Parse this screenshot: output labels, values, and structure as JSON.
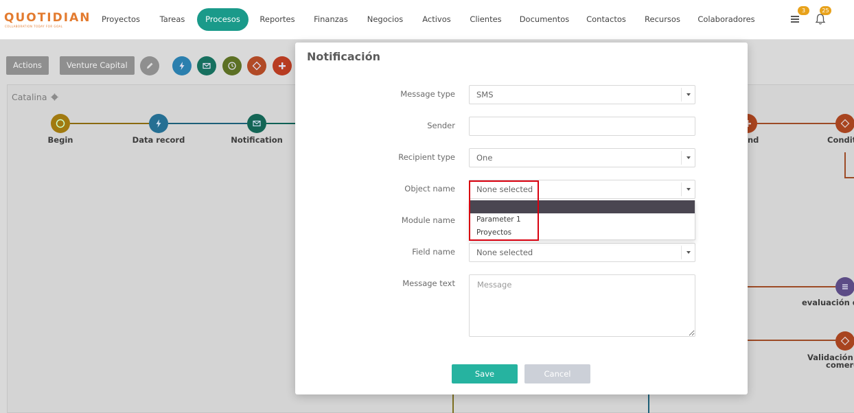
{
  "brand": {
    "logo_text": "QUOTIDIAN",
    "logo_tagline": "COLLABORATION TODAY FOR GOAL",
    "accent": "#e37b2f"
  },
  "nav": {
    "items": [
      {
        "label": "Proyectos"
      },
      {
        "label": "Tareas"
      },
      {
        "label": "Procesos",
        "active": true
      },
      {
        "label": "Reportes"
      },
      {
        "label": "Finanzas"
      },
      {
        "label": "Negocios"
      },
      {
        "label": "Activos"
      },
      {
        "label": "Clientes"
      },
      {
        "label": "Documentos"
      },
      {
        "label": "Contactos"
      },
      {
        "label": "Recursos"
      },
      {
        "label": "Colaboradores"
      }
    ],
    "active_color": "#1a9a8a",
    "tasks_badge": "3",
    "notifications_badge": "25"
  },
  "toolbar": {
    "actions_label": "Actions",
    "process_label": "Venture Capital",
    "tool_icons": [
      "pencil-icon",
      "lightning-icon",
      "envelope-icon",
      "clock-icon",
      "diamond-icon",
      "plus-icon"
    ]
  },
  "canvas": {
    "title": "Catalina",
    "nodes": {
      "begin": "Begin",
      "data_record": "Data record",
      "notification": "Notification",
      "right_partial": "nd",
      "condition_partial": "Conditi",
      "evaluation_partial": "evaluación do",
      "validation_line1_partial": "Validación t",
      "validation_line2_partial": "comerc"
    }
  },
  "modal": {
    "title": "Notificación",
    "fields": {
      "message_type": {
        "label": "Message type",
        "value": "SMS"
      },
      "sender": {
        "label": "Sender",
        "value": ""
      },
      "recipient_type": {
        "label": "Recipient type",
        "value": "One"
      },
      "object_name": {
        "label": "Object name",
        "value": "None selected",
        "options": [
          "",
          "Parameter 1",
          "Proyectos"
        ]
      },
      "module_name": {
        "label": "Module name"
      },
      "field_name": {
        "label": "Field name",
        "value": "None selected"
      },
      "message_text": {
        "label": "Message text",
        "placeholder": "Message"
      }
    },
    "save_label": "Save",
    "cancel_label": "Cancel"
  }
}
